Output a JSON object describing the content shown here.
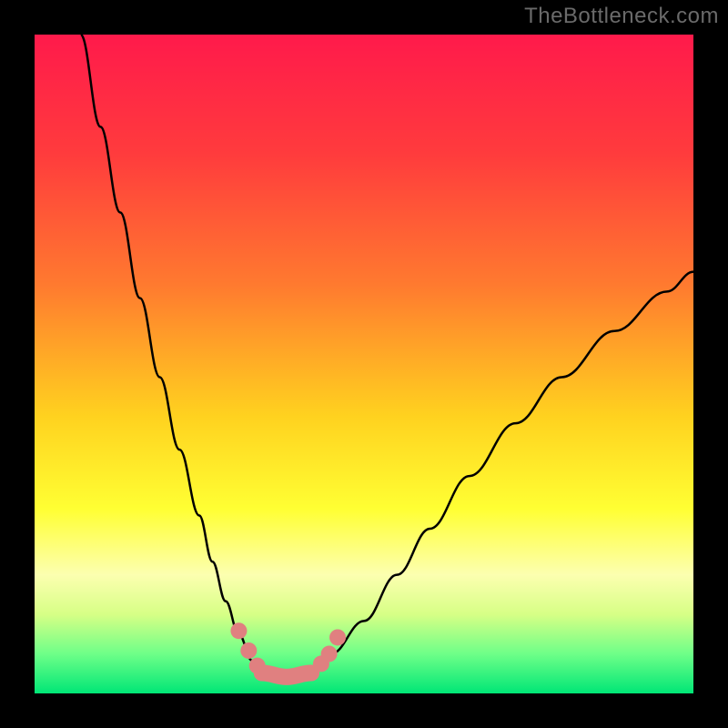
{
  "attribution": "TheBottleneck.com",
  "colors": {
    "frame": "#000000",
    "attribution_text": "#6a6a6a",
    "curve": "#000000",
    "marker": "#e08080",
    "gradient_stops": [
      {
        "offset": 0.0,
        "color": "#ff1a4b"
      },
      {
        "offset": 0.18,
        "color": "#ff3b3d"
      },
      {
        "offset": 0.38,
        "color": "#ff7a2f"
      },
      {
        "offset": 0.58,
        "color": "#ffd21f"
      },
      {
        "offset": 0.72,
        "color": "#ffff33"
      },
      {
        "offset": 0.82,
        "color": "#fcffb0"
      },
      {
        "offset": 0.88,
        "color": "#d7ff86"
      },
      {
        "offset": 0.94,
        "color": "#6eff88"
      },
      {
        "offset": 1.0,
        "color": "#00e676"
      }
    ]
  },
  "chart_data": {
    "type": "line",
    "title": "",
    "xlabel": "",
    "ylabel": "",
    "xlim": [
      0,
      100
    ],
    "ylim": [
      0,
      100
    ],
    "grid": false,
    "legend": false,
    "note": "Values read from pixel geometry; axes unlabeled so units are percent of plot area. y=100 is top of colored region, y=0 is bottom.",
    "series": [
      {
        "name": "left-branch",
        "x": [
          7,
          10,
          13,
          16,
          19,
          22,
          25,
          27,
          29,
          31,
          33,
          34.5
        ],
        "y": [
          100,
          86,
          73,
          60,
          48,
          37,
          27,
          20,
          14,
          9,
          5,
          3
        ]
      },
      {
        "name": "right-branch",
        "x": [
          42,
          45,
          50,
          55,
          60,
          66,
          73,
          80,
          88,
          96,
          100
        ],
        "y": [
          3,
          6,
          11,
          18,
          25,
          33,
          41,
          48,
          55,
          61,
          64
        ]
      },
      {
        "name": "flat-bottom",
        "x": [
          34.5,
          36,
          38,
          40,
          42
        ],
        "y": [
          3,
          2.3,
          2.1,
          2.3,
          3
        ]
      }
    ],
    "markers": {
      "name": "highlighted-points",
      "points": [
        {
          "x": 31.0,
          "y": 9.5
        },
        {
          "x": 32.5,
          "y": 6.5
        },
        {
          "x": 33.8,
          "y": 4.2
        },
        {
          "x": 43.5,
          "y": 4.5
        },
        {
          "x": 44.7,
          "y": 6.0
        },
        {
          "x": 46.0,
          "y": 8.5
        }
      ],
      "bottom_run": {
        "x_start": 34.5,
        "x_end": 42.0,
        "y": 2.5
      }
    }
  }
}
